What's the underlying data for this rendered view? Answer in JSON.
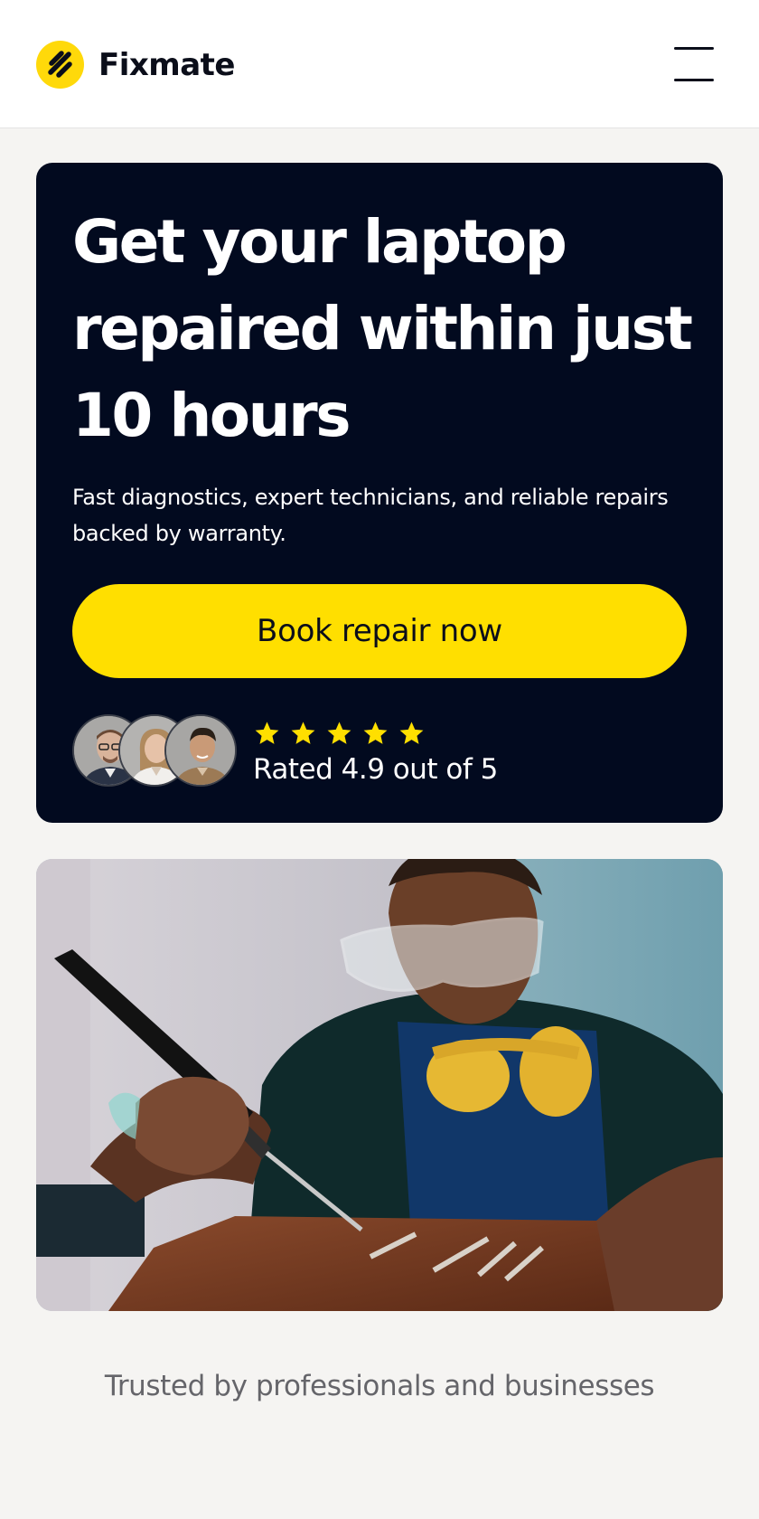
{
  "header": {
    "brand_name": "Fixmate",
    "menu_icon": "hamburger-menu-icon"
  },
  "hero": {
    "title": "Get your laptop repaired within just 10 hours",
    "subtitle": "Fast diagnostics, expert technicians, and reliable repairs backed by warranty.",
    "cta_label": "Book repair now",
    "rating": {
      "stars": 5,
      "text": "Rated 4.9 out of 5"
    }
  },
  "trusted": {
    "text": "Trusted by professionals and businesses"
  },
  "colors": {
    "accent": "#ffdf00",
    "hero_background": "#020a1f",
    "page_background": "#f5f4f2"
  }
}
